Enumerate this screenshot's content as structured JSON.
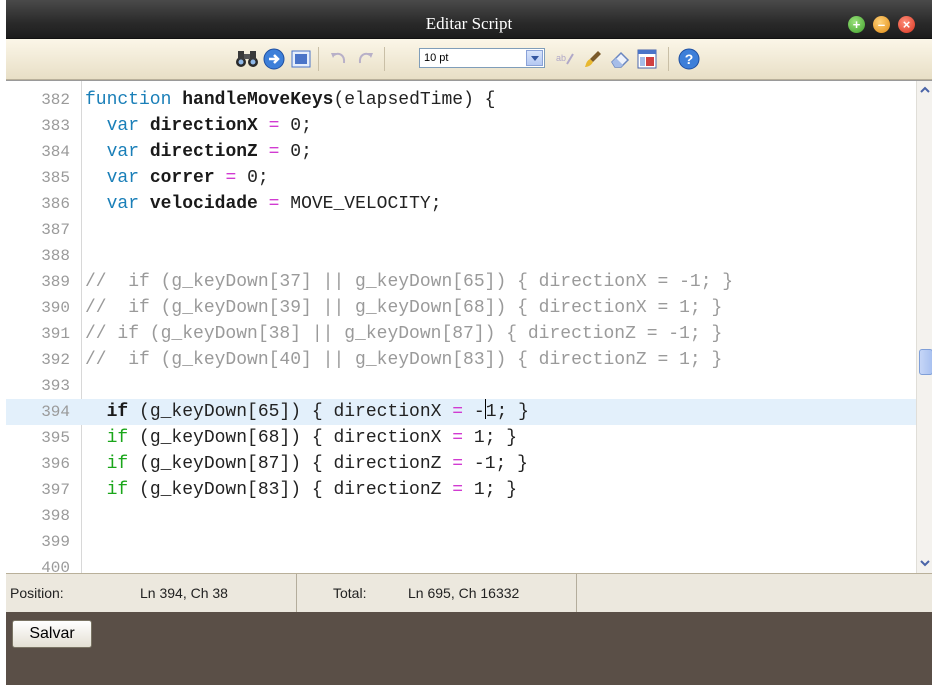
{
  "window": {
    "title": "Editar Script"
  },
  "toolbar": {
    "font_size": "10 pt"
  },
  "editor": {
    "lines": [
      {
        "n": "382",
        "tokens": [
          [
            "kw",
            "function "
          ],
          [
            "fn",
            "handleMoveKeys"
          ],
          [
            "p",
            "(elapsedTime) {"
          ]
        ]
      },
      {
        "n": "383",
        "tokens": [
          [
            "p",
            "  "
          ],
          [
            "kw",
            "var "
          ],
          [
            "fn",
            "directionX "
          ],
          [
            "op",
            "="
          ],
          [
            "p",
            " 0;"
          ]
        ]
      },
      {
        "n": "384",
        "tokens": [
          [
            "p",
            "  "
          ],
          [
            "kw",
            "var "
          ],
          [
            "fn",
            "directionZ "
          ],
          [
            "op",
            "="
          ],
          [
            "p",
            " 0;"
          ]
        ]
      },
      {
        "n": "385",
        "tokens": [
          [
            "p",
            "  "
          ],
          [
            "kw",
            "var "
          ],
          [
            "fn",
            "correr "
          ],
          [
            "op",
            "="
          ],
          [
            "p",
            " 0;"
          ]
        ]
      },
      {
        "n": "386",
        "tokens": [
          [
            "p",
            "  "
          ],
          [
            "kw",
            "var "
          ],
          [
            "fn",
            "velocidade "
          ],
          [
            "op",
            "="
          ],
          [
            "p",
            " MOVE_VELOCITY;"
          ]
        ]
      },
      {
        "n": "387",
        "tokens": []
      },
      {
        "n": "388",
        "tokens": []
      },
      {
        "n": "389",
        "tokens": [
          [
            "cm",
            "//  if (g_keyDown[37] || g_keyDown[65]) { directionX = -1; }"
          ]
        ]
      },
      {
        "n": "390",
        "tokens": [
          [
            "cm",
            "//  if (g_keyDown[39] || g_keyDown[68]) { directionX = 1; }"
          ]
        ]
      },
      {
        "n": "391",
        "tokens": [
          [
            "cm",
            "// if (g_keyDown[38] || g_keyDown[87]) { directionZ = -1; }"
          ]
        ]
      },
      {
        "n": "392",
        "tokens": [
          [
            "cm",
            "//  if (g_keyDown[40] || g_keyDown[83]) { directionZ = 1; }"
          ]
        ]
      },
      {
        "n": "393",
        "tokens": []
      },
      {
        "n": "394",
        "current": true,
        "tokens": [
          [
            "p",
            "  "
          ],
          [
            "fn",
            "if "
          ],
          [
            "p",
            "(g_keyDown[65]) { directionX "
          ],
          [
            "op",
            "="
          ],
          [
            "p",
            " -"
          ],
          [
            "cursor",
            ""
          ],
          [
            "p",
            "1; }"
          ]
        ]
      },
      {
        "n": "395",
        "tokens": [
          [
            "p",
            "  "
          ],
          [
            "kwg",
            "if "
          ],
          [
            "p",
            "(g_keyDown[68]) { directionX "
          ],
          [
            "op",
            "="
          ],
          [
            "p",
            " 1; }"
          ]
        ]
      },
      {
        "n": "396",
        "tokens": [
          [
            "p",
            "  "
          ],
          [
            "kwg",
            "if "
          ],
          [
            "p",
            "(g_keyDown[87]) { directionZ "
          ],
          [
            "op",
            "="
          ],
          [
            "p",
            " -1; }"
          ]
        ]
      },
      {
        "n": "397",
        "tokens": [
          [
            "p",
            "  "
          ],
          [
            "kwg",
            "if "
          ],
          [
            "p",
            "(g_keyDown[83]) { directionZ "
          ],
          [
            "op",
            "="
          ],
          [
            "p",
            " 1; }"
          ]
        ]
      },
      {
        "n": "398",
        "tokens": []
      },
      {
        "n": "399",
        "tokens": []
      },
      {
        "n": "400",
        "tokens": []
      }
    ]
  },
  "status": {
    "position_label": "Position:",
    "position_value": "Ln 394, Ch 38",
    "total_label": "Total:",
    "total_value": "Ln 695, Ch 16332"
  },
  "footer": {
    "save_label": "Salvar"
  },
  "icons": {
    "find": "binoculars-icon",
    "goto": "go-arrow-icon",
    "select-all": "select-all-icon",
    "undo": "undo-icon",
    "redo": "redo-icon",
    "word-wrap": "word-wrap-icon",
    "format": "brush-icon",
    "clear": "eraser-icon",
    "fullscreen": "window-icon",
    "help": "help-icon"
  }
}
